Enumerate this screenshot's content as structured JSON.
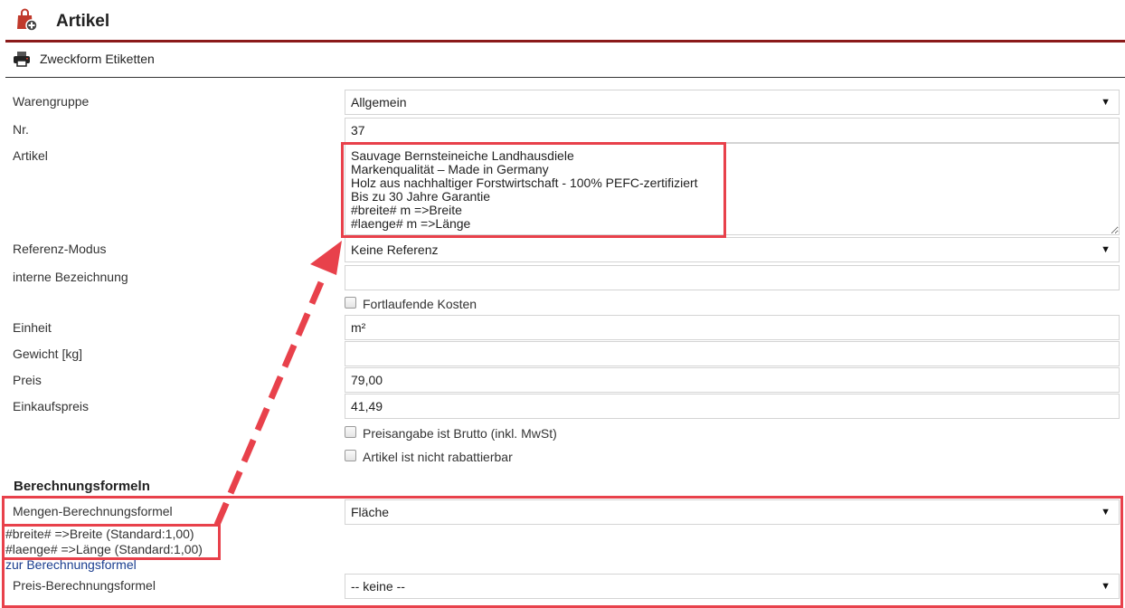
{
  "header": {
    "title": "Artikel"
  },
  "toolbar": {
    "print_label": "Zweckform Etiketten"
  },
  "form": {
    "warengruppe": {
      "label": "Warengruppe",
      "value": "Allgemein"
    },
    "nr": {
      "label": "Nr.",
      "value": "37"
    },
    "artikel": {
      "label": "Artikel",
      "value": "Sauvage Bernsteineiche Landhausdiele\nMarkenqualität – Made in Germany\nHolz aus nachhaltiger Forstwirtschaft - 100% PEFC-zertifiziert\nBis zu 30 Jahre Garantie\n#breite# m =>Breite\n#laenge# m =>Länge"
    },
    "referenz_modus": {
      "label": "Referenz-Modus",
      "value": "Keine Referenz"
    },
    "interne_bezeichnung": {
      "label": "interne Bezeichnung",
      "value": ""
    },
    "fortlaufende_kosten": {
      "label": "Fortlaufende Kosten",
      "checked": false
    },
    "einheit": {
      "label": "Einheit",
      "value": "m²"
    },
    "gewicht": {
      "label": "Gewicht [kg]",
      "value": ""
    },
    "preis": {
      "label": "Preis",
      "value": "79,00"
    },
    "einkaufspreis": {
      "label": "Einkaufspreis",
      "value": "41,49"
    },
    "preisangabe_brutto": {
      "label": "Preisangabe ist Brutto (inkl. MwSt)",
      "checked": false
    },
    "nicht_rabattierbar": {
      "label": "Artikel ist nicht rabattierbar",
      "checked": false
    }
  },
  "berechnung": {
    "title": "Berechnungsformeln",
    "mengen": {
      "label": "Mengen-Berechnungsformel",
      "value": "Fläche"
    },
    "hints": [
      "#breite# =>Breite (Standard:1,00)",
      "#laenge# =>Länge (Standard:1,00)"
    ],
    "link": "zur Berechnungsformel",
    "preis": {
      "label": "Preis-Berechnungsformel",
      "value": "-- keine --"
    }
  },
  "colors": {
    "accent_rule": "#8b1a1a",
    "annotation": "#e8414b",
    "link": "#1a3d8f"
  },
  "icons": {
    "app": "shopping-bag-add-icon",
    "print": "printer-icon",
    "dropdown": "caret-down-icon"
  }
}
